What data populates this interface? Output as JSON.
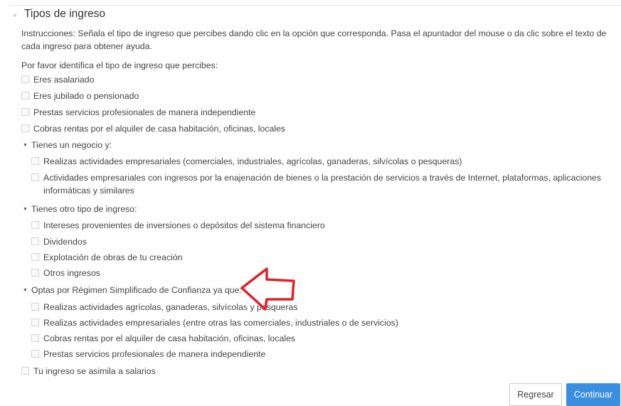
{
  "section": {
    "title": "Tipos de ingreso",
    "collapse_icon": "»",
    "instructions": "Instrucciones: Señala el tipo de ingreso que percibes dando clic en la opción que corresponda. Pasa el apuntador del mouse o da clic sobre el texto de cada ingreso para obtener ayuda.",
    "prompt": "Por favor identifica el tipo de ingreso que percibes:"
  },
  "options": [
    "Eres asalariado",
    "Eres jubilado o pensionado",
    "Prestas servicios profesionales de manera independiente",
    "Cobras rentas por el alquiler de casa habitación, oficinas, locales"
  ],
  "groups": [
    {
      "label": "Tienes un negocio y:",
      "items": [
        "Realizas actividades empresariales (comerciales, industriales, agrícolas, ganaderas, silvícolas o pesqueras)",
        "Actividades empresariales con ingresos por la enajenación de bienes o la prestación de servicios a través de Internet, plataformas, aplicaciones informáticas y similares"
      ]
    },
    {
      "label": "Tienes otro tipo de ingreso:",
      "items": [
        "Intereses provenientes de inversiones o depósitos del sistema financiero",
        "Dividendos",
        "Explotación de obras de tu creación",
        "Otros ingresos"
      ]
    },
    {
      "label": "Optas por Régimen Simplificado de Confianza ya que:",
      "items": [
        "Realizas actividades agrícolas, ganaderas, silvícolas y pesqueras",
        "Realizas actividades empresariales (entre otras las comerciales, industriales o de servicios)",
        "Cobras rentas por el alquiler de casa habitación, oficinas, locales",
        "Prestas servicios profesionales de manera independiente"
      ]
    }
  ],
  "last_option": "Tu ingreso se asimila a salarios",
  "buttons": {
    "back": "Regresar",
    "next": "Continuar"
  },
  "colors": {
    "primary": "#3a8fe0",
    "annotation_arrow": "#e0202a"
  }
}
